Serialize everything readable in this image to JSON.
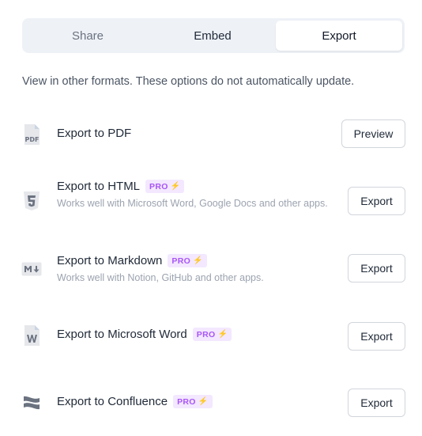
{
  "tabs": {
    "share": "Share",
    "embed": "Embed",
    "export": "Export"
  },
  "intro": "View in other formats. These options do not automatically update.",
  "pro_label": "PRO",
  "items": [
    {
      "title": "Export to PDF",
      "pro": false,
      "subtitle": "",
      "button": "Preview",
      "icon": "pdf-icon"
    },
    {
      "title": "Export to HTML",
      "pro": true,
      "subtitle": "Works well with Microsoft Word, Google Docs and other apps.",
      "button": "Export",
      "icon": "html5-icon"
    },
    {
      "title": "Export to Markdown",
      "pro": true,
      "subtitle": "Works well with Notion, GitHub and other apps.",
      "button": "Export",
      "icon": "markdown-icon"
    },
    {
      "title": "Export to Microsoft Word",
      "pro": true,
      "subtitle": "",
      "button": "Export",
      "icon": "word-icon"
    },
    {
      "title": "Export to Confluence",
      "pro": true,
      "subtitle": "",
      "button": "Export",
      "icon": "confluence-icon"
    }
  ],
  "colors": {
    "pro_bg": "#f3e8ff",
    "pro_text": "#a855f7",
    "icon": "#6b7280"
  }
}
